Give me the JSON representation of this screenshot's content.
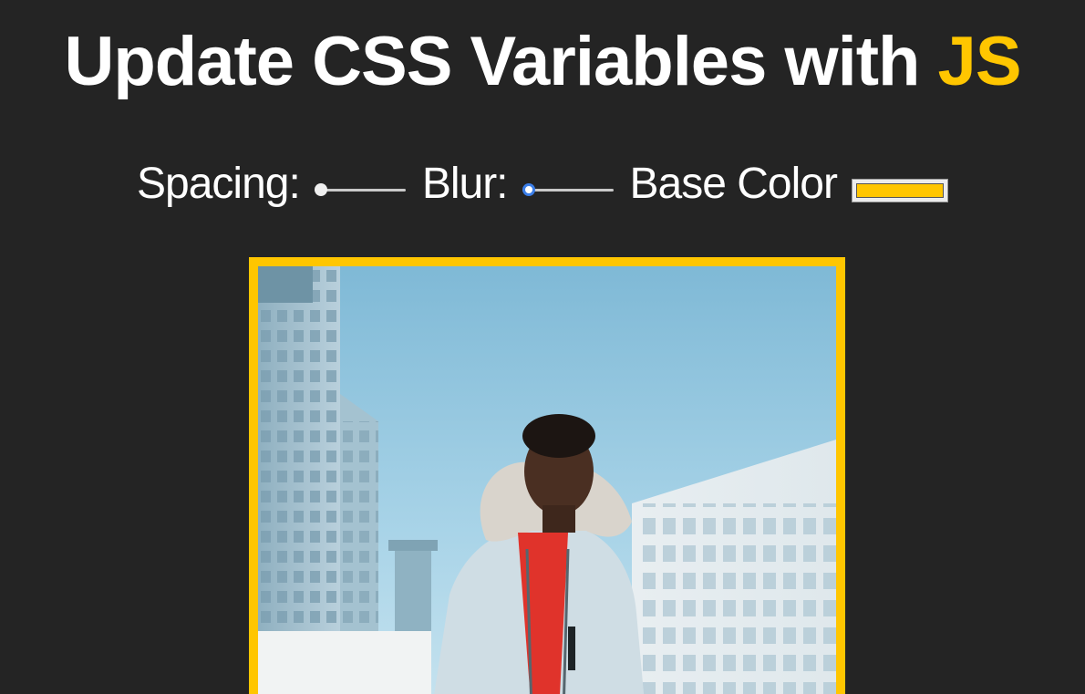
{
  "heading": {
    "text": "Update CSS Variables with ",
    "highlight": "JS"
  },
  "controls": {
    "spacing_label": "Spacing:",
    "spacing_value_fraction": 0.0,
    "blur_label": "Blur:",
    "blur_value_fraction": 0.0,
    "base_color_label": "Base Color",
    "base_color_value": "#ffc600"
  },
  "colors": {
    "background": "#242424",
    "accent": "#ffc600",
    "text": "#ffffff"
  },
  "photo": {
    "icon": "photo-image"
  }
}
